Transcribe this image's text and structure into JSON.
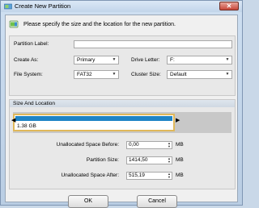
{
  "window": {
    "title": "Create New Partition",
    "close_glyph": "✕"
  },
  "header": {
    "text": "Please specify the size and the location for the new partition.",
    "icon": "partition-wizard-icon"
  },
  "fields": {
    "partition_label": {
      "label": "Partition Label:",
      "value": ""
    },
    "create_as": {
      "label": "Create As:",
      "value": "Primary"
    },
    "drive_letter": {
      "label": "Drive Letter:",
      "value": "F:"
    },
    "file_system": {
      "label": "File System:",
      "value": "FAT32"
    },
    "cluster_size": {
      "label": "Cluster Size:",
      "value": "Default"
    }
  },
  "size_location": {
    "title": "Size And Location",
    "partition_size_display": "1.38 GB",
    "fill_fraction": 0.74,
    "unallocated_before": {
      "label": "Unallocated Space Before:",
      "value": "0,00",
      "unit": "MB"
    },
    "partition_size": {
      "label": "Partition Size:",
      "value": "1414,50",
      "unit": "MB"
    },
    "unallocated_after": {
      "label": "Unallocated Space After:",
      "value": "515,19",
      "unit": "MB"
    }
  },
  "buttons": {
    "ok": "OK",
    "cancel": "Cancel"
  },
  "colors": {
    "partition_bar": "#1f84c6",
    "selection_border": "#e0b85a",
    "close_button": "#c7473a"
  },
  "glyphs": {
    "dropdown": "▼",
    "spin_up": "▲",
    "spin_down": "▼",
    "handle_left": "◀",
    "handle_right": "▶"
  }
}
